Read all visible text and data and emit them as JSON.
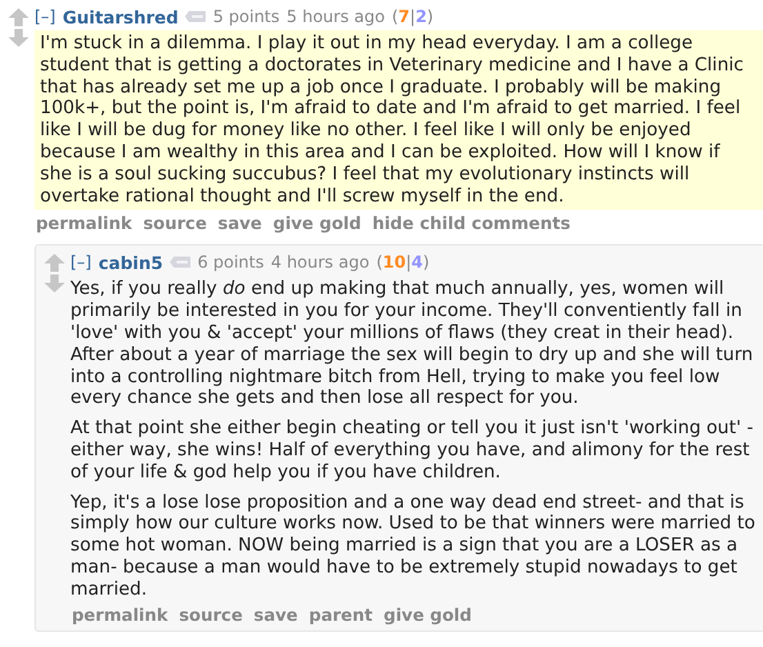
{
  "comments": [
    {
      "toggle": "[–]",
      "author": "Guitarshred",
      "score": "5 points",
      "time": "5 hours ago",
      "votes": {
        "open": "(",
        "ups": "7",
        "sep": "|",
        "downs": "2",
        "close": ")"
      },
      "highlighted": true,
      "paragraphs": [
        "I'm stuck in a dilemma. I play it out in my head everyday. I am a college student that is getting a doctorates in Veterinary medicine and I have a Clinic that has already set me up a job once I graduate. I probably will be making 100k+, but the point is, I'm afraid to date and I'm afraid to get married. I feel like I will be dug for money like no other. I feel like I will only be enjoyed because I am wealthy in this area and I can be exploited. How will I know if she is a soul sucking succubus? I feel that my evolutionary instincts will overtake rational thought and I'll screw myself in the end."
      ],
      "actions": [
        "permalink",
        "source",
        "save",
        "give gold",
        "hide child comments"
      ],
      "children": [
        {
          "toggle": "[–]",
          "author": "cabin5",
          "score": "6 points",
          "time": "4 hours ago",
          "votes": {
            "open": "(",
            "ups": "10",
            "sep": "|",
            "downs": "4",
            "close": ")"
          },
          "highlighted": false,
          "paragraphs": [
            "Yes, if you really *do* end up making that much annually, yes, women will primarily be interested in you for your income. They'll conventiently fall in 'love' with you & 'accept' your millions of flaws (they creat in their head). After about a year of marriage the sex will begin to dry up and she will turn into a controlling nightmare bitch from Hell, trying to make you feel low every chance she gets and then lose all respect for you.",
            "At that point she either begin cheating or tell you it just isn't 'working out' - either way, she wins! Half of everything you have, and alimony for the rest of your life & god help you if you have children.",
            "Yep, it's a lose lose proposition and a one way dead end street- and that is simply how our culture works now. Used to be that winners were married to some hot woman. NOW being married is a sign that you are a LOSER as a man- because a man would have to be extremely stupid nowadays to get married."
          ],
          "actions": [
            "permalink",
            "source",
            "save",
            "parent",
            "give gold"
          ]
        }
      ]
    }
  ]
}
